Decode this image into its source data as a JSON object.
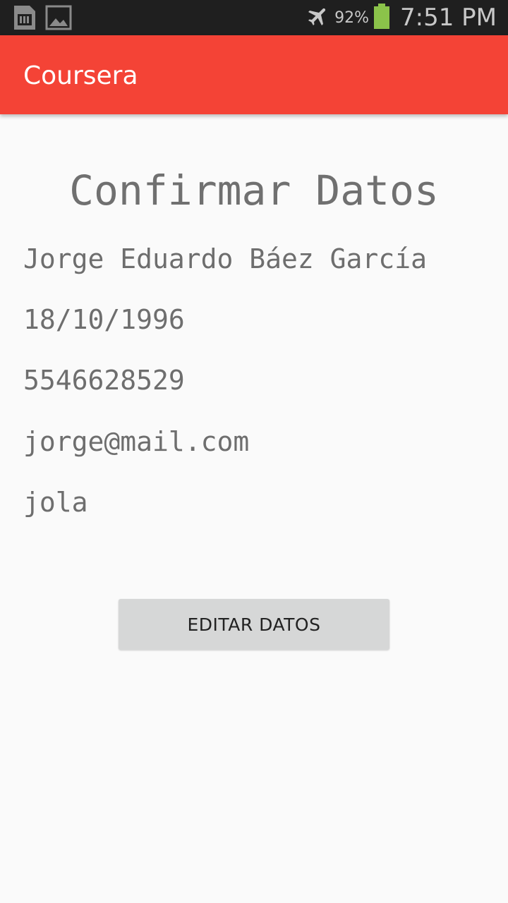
{
  "status_bar": {
    "left_icons": [
      "sd-card-icon",
      "image-icon"
    ],
    "right_icons": [
      "airplane-mode-icon",
      "battery-icon"
    ],
    "battery_percent": "92%",
    "battery_level": 0.92,
    "time": "7:51 PM",
    "colors": {
      "background": "#1f1f1f",
      "battery": "#8bc34a"
    }
  },
  "app_bar": {
    "title": "Coursera",
    "color": "#f44336"
  },
  "main": {
    "heading": "Confirmar Datos",
    "fields": {
      "name": "Jorge Eduardo Báez García",
      "birth_date": "18/10/1996",
      "phone": "5546628529",
      "email": "jorge@mail.com",
      "description": "jola"
    },
    "edit_button_label": "EDITAR DATOS"
  }
}
